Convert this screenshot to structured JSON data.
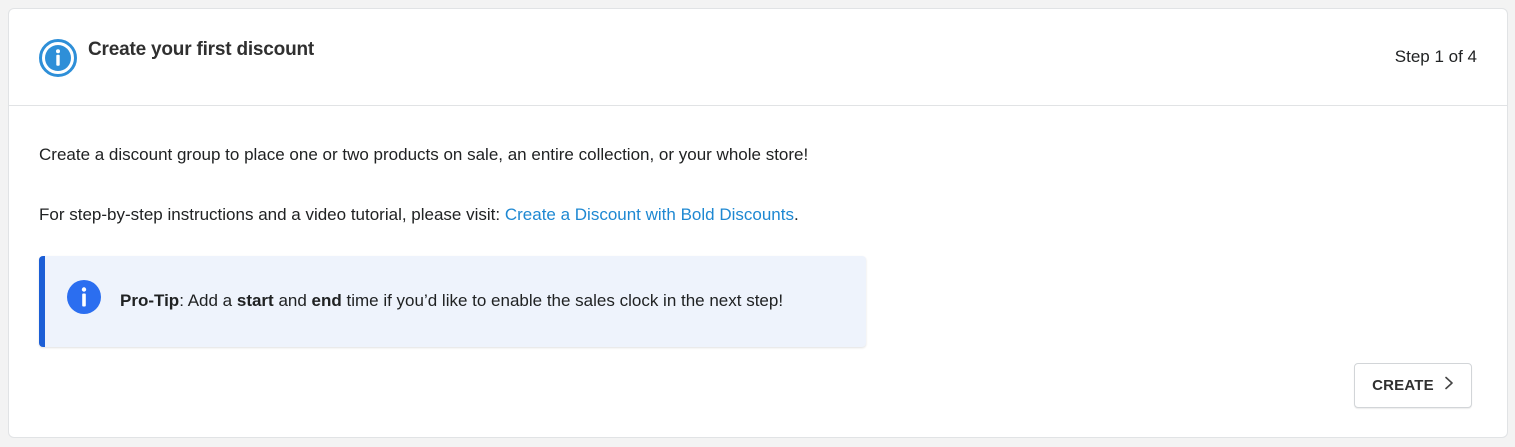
{
  "header": {
    "title": "Create your first discount",
    "step": "Step 1 of 4",
    "icon": "info-circle-icon"
  },
  "body": {
    "description": "Create a discount group to place one or two products on sale, an entire collection, or your whole store!",
    "instructions_prefix": "For step-by-step instructions and a video tutorial, please visit: ",
    "instructions_link": "Create a Discount with Bold Discounts",
    "instructions_suffix": "."
  },
  "protip": {
    "icon": "info-filled-icon",
    "label": "Pro-Tip",
    "text_1": ": Add a ",
    "start": "start",
    "text_2": " and ",
    "end": "end",
    "text_3": " time if you’d like to enable the sales clock in the next step!"
  },
  "actions": {
    "create_label": "CREATE",
    "create_icon": "chevron-right-icon"
  },
  "colors": {
    "link": "#1e88d2",
    "accent": "#1c5ed6",
    "protip_bg": "#eef3fc",
    "header_icon": "#2e8fd8"
  }
}
